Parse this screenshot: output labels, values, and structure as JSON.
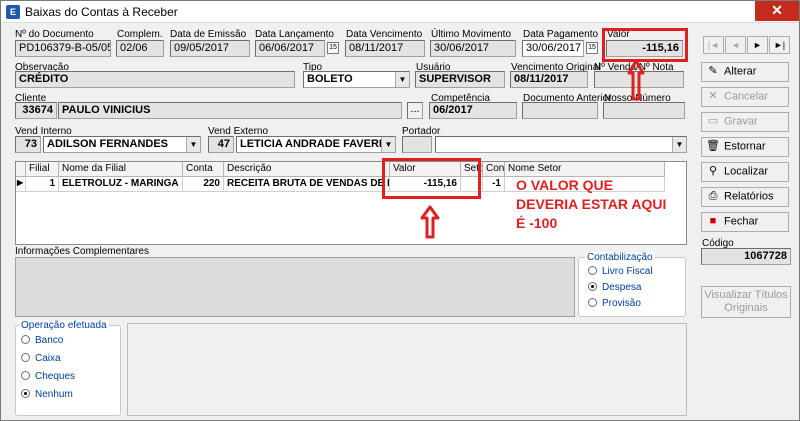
{
  "window": {
    "title": "Baixas do Contas à Receber",
    "close_glyph": "✕",
    "app_icon_glyph": "E"
  },
  "labels": {
    "doc_number": "Nº do Documento",
    "complement": "Complem.",
    "issue_date": "Data de Emissão",
    "launch_date": "Data Lançamento",
    "due_date": "Data Vencimento",
    "last_movement": "Último Movimento",
    "payment_date": "Data Pagamento",
    "value": "Valor",
    "observation": "Observação",
    "type": "Tipo",
    "user": "Usuário",
    "original_due": "Vencimento Original",
    "invoice_sale": "Nº Venda/Nº Nota",
    "client": "Cliente",
    "competence": "Competência",
    "previous_doc": "Documento Anterior",
    "our_number": "Nosso Número",
    "internal_seller": "Vend Interno",
    "external_seller": "Vend Externo",
    "carrier": "Portador",
    "code": "Código",
    "complementary_info": "Informações Complementares"
  },
  "fields": {
    "doc_number": "PD106379-B-05/05-I",
    "complement": "02/06",
    "issue_date": "09/05/2017",
    "launch_date": "06/06/2017",
    "due_date": "08/11/2017",
    "last_movement": "30/06/2017",
    "payment_date": "30/06/2017",
    "value": "-115,16",
    "observation": "CRÉDITO",
    "type": "BOLETO",
    "user": "SUPERVISOR",
    "original_due": "08/11/2017",
    "invoice_sale": "",
    "client_code": "33674",
    "client_name": "PAULO VINICIUS",
    "ellipsis": "...",
    "competence": "06/2017",
    "previous_doc": "",
    "our_number": "",
    "internal_seller_code": "73",
    "internal_seller_name": "ADILSON FERNANDES",
    "external_seller_code": "47",
    "external_seller_name": "LETICIA ANDRADE FAVERI MA",
    "carrier_code": "",
    "carrier_name": "",
    "code": "1067728"
  },
  "grid": {
    "headers": [
      "Filial",
      "Nome da Filial",
      "Conta",
      "Descrição",
      "Valor",
      "Setor",
      "Cons",
      "Nome Setor"
    ],
    "rows": [
      {
        "indicator": "▶",
        "filial": "1",
        "branch_name": "ELETROLUZ - MARINGA",
        "account": "220",
        "description": "RECEITA BRUTA DE VENDAS DE PRODUTO",
        "value": "-115,16",
        "sector": "",
        "cons": "-1",
        "sector_name": ""
      }
    ]
  },
  "nav_buttons": [
    "|◄",
    "◄",
    "►",
    "►|"
  ],
  "side_buttons": [
    {
      "label": "Alterar",
      "icon": "edit-icon",
      "glyph": "✎",
      "enabled": true
    },
    {
      "label": "Cancelar",
      "icon": "cancel-icon",
      "glyph": "✕",
      "enabled": false
    },
    {
      "label": "Gravar",
      "icon": "save-icon",
      "glyph": "▭",
      "enabled": false
    },
    {
      "label": "Estornar",
      "icon": "reverse-icon",
      "glyph": "🗑",
      "enabled": true
    },
    {
      "label": "Localizar",
      "icon": "search-icon",
      "glyph": "⚲",
      "enabled": true
    },
    {
      "label": "Relatórios",
      "icon": "print-icon",
      "glyph": "⎙",
      "enabled": true
    },
    {
      "label": "Fechar",
      "icon": "exit-icon",
      "glyph": "■",
      "enabled": true
    }
  ],
  "view_original_titles": {
    "line1": "Visualizar Títulos",
    "line2": "Originais"
  },
  "contabilizacao": {
    "title": "Contabilização",
    "options": [
      "Livro Fiscal",
      "Despesa",
      "Provisão"
    ],
    "selected": "Despesa"
  },
  "operacao": {
    "title": "Operação efetuada",
    "options": [
      "Banco",
      "Caixa",
      "Cheques",
      "Nenhum"
    ],
    "selected": "Nenhum"
  },
  "annotation": {
    "line1": "O VALOR QUE",
    "line2": "DEVERIA ESTAR AQUI",
    "line3": "É -100",
    "color": "#e02020"
  },
  "icons": {
    "calendar": "calendar-icon",
    "dropdown": "chevron-down-icon",
    "arrow_up": "arrow-up-icon"
  }
}
